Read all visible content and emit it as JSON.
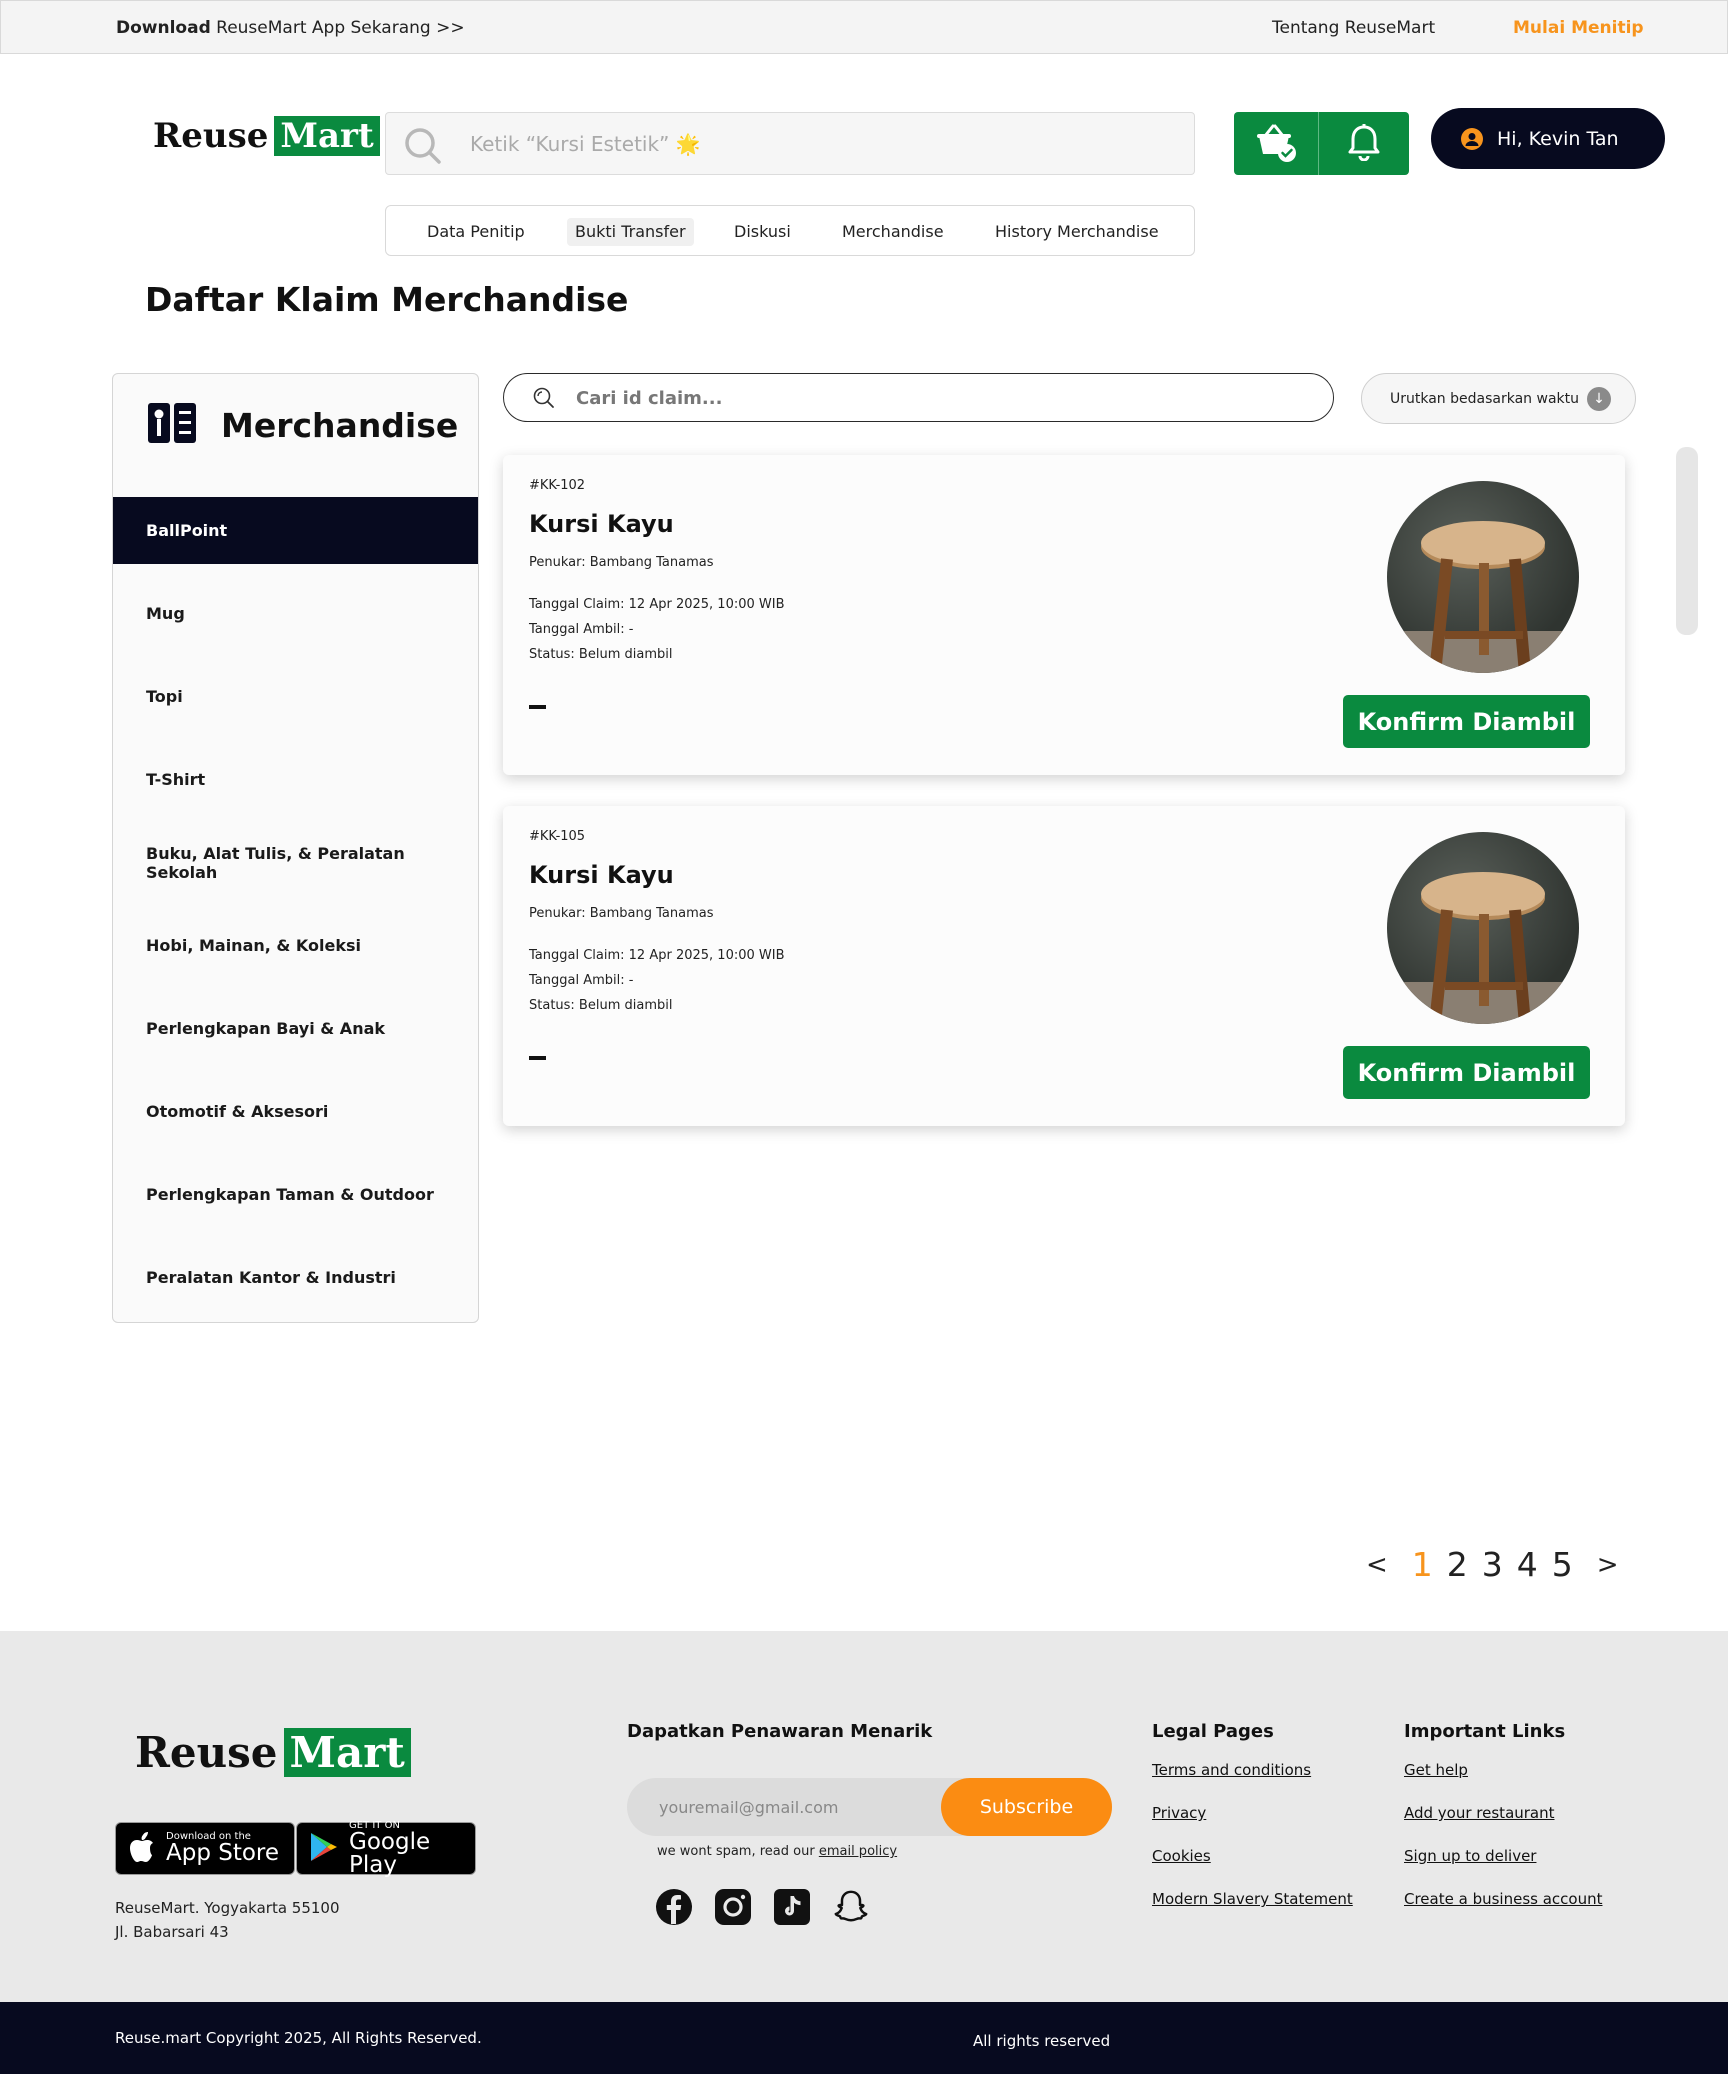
{
  "topbar": {
    "download_bold": "Download",
    "download_rest": " ReuseMart App Sekarang >>",
    "about": "Tentang ReuseMart",
    "cta": "Mulai Menitip"
  },
  "logo": {
    "part1": "Reuse",
    "part2": "Mart"
  },
  "search": {
    "placeholder": "Ketik “Kursi Estetik” 🌟"
  },
  "user": {
    "greeting": "Hi, Kevin Tan"
  },
  "nav": {
    "tabs": [
      "Data Penitip",
      "Bukti Transfer",
      "Diskusi",
      "Merchandise",
      "History Merchandise"
    ],
    "active": "Bukti Transfer"
  },
  "page": {
    "title": "Daftar Klaim Merchandise"
  },
  "sidebar": {
    "title": "Merchandise",
    "items": [
      "BallPoint",
      "Mug",
      "Topi",
      "T-Shirt",
      "Buku, Alat Tulis, & Peralatan Sekolah",
      "Hobi, Mainan, & Koleksi",
      "Perlengkapan Bayi & Anak",
      "Otomotif & Aksesori",
      "Perlengkapan Taman & Outdoor",
      "Peralatan Kantor & Industri"
    ],
    "active": "BallPoint"
  },
  "claims": {
    "search_placeholder": "Cari id claim...",
    "sort_label": "Urutkan bedasarkan waktu",
    "items": [
      {
        "id": "#KK-102",
        "name": "Kursi Kayu",
        "penukar": "Penukar: Bambang Tanamas",
        "tanggal_claim": "Tanggal Claim: 12 Apr 2025, 10:00 WIB",
        "tanggal_ambil": "Tanggal Ambil: -",
        "status": "Status: Belum diambil",
        "button": "Konfirm Diambil"
      },
      {
        "id": "#KK-105",
        "name": "Kursi Kayu",
        "penukar": "Penukar: Bambang Tanamas",
        "tanggal_claim": "Tanggal Claim: 12 Apr 2025, 10:00 WIB",
        "tanggal_ambil": "Tanggal Ambil: -",
        "status": "Status: Belum diambil",
        "button": "Konfirm Diambil"
      }
    ]
  },
  "pagination": {
    "prev": "<",
    "pages": [
      "1",
      "2",
      "3",
      "4",
      "5"
    ],
    "current": "1",
    "next": ">"
  },
  "footer": {
    "appstore_small": "Download on the",
    "appstore_big": "App Store",
    "googleplay_small": "GET IT ON",
    "googleplay_big": "Google Play",
    "address_line1": "ReuseMart. Yogyakarta 55100",
    "address_line2": "Jl. Babarsari 43",
    "newsletter_title": "Dapatkan Penawaran Menarik",
    "email_placeholder": "youremail@gmail.com",
    "subscribe": "Subscribe",
    "spam_note": "we wont spam, read our ",
    "spam_link": "email policy",
    "social_icons": [
      "facebook-icon",
      "instagram-icon",
      "tiktok-icon",
      "snapchat-icon"
    ],
    "legal_title": "Legal Pages",
    "legal_links": [
      "Terms and conditions",
      "Privacy",
      "Cookies",
      "Modern Slavery Statement"
    ],
    "important_title": "Important Links",
    "important_links": [
      "Get help",
      "Add your restaurant",
      "Sign up to deliver",
      "Create a business account"
    ],
    "copyright": "Reuse.mart Copyright 2025, All Rights Reserved.",
    "rights": "All rights reserved"
  },
  "colors": {
    "brand_green": "#0a8a3f",
    "accent_orange": "#f7941d",
    "navy": "#070a1f"
  }
}
